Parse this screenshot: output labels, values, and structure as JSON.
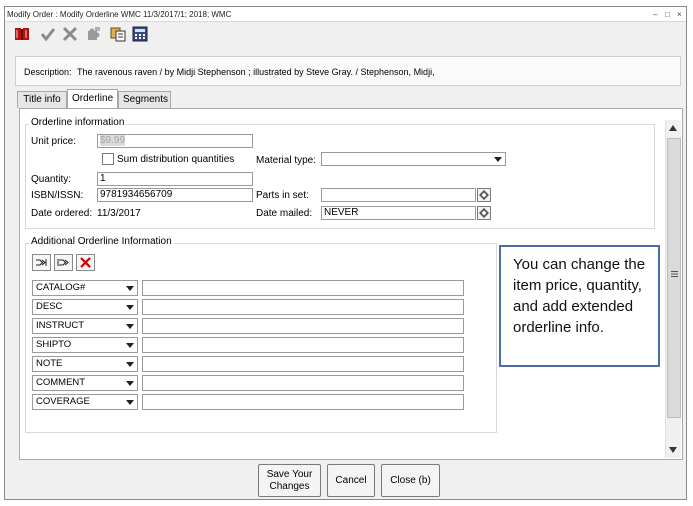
{
  "window": {
    "title": "Modify Order : Modify Orderline  WMC 11/3/2017/1; 2018; WMC",
    "controls": [
      "‒",
      "□",
      "×"
    ]
  },
  "toolbar": {
    "icons": [
      "book-icon",
      "checkmark-icon",
      "tools-icon",
      "puzzle-icon",
      "copy-icon",
      "calculator-icon"
    ]
  },
  "description": {
    "label": "Description:",
    "value": "The ravenous raven / by Midji Stephenson ; illustrated by Steve Gray. / Stephenson, Midji,"
  },
  "tabs": [
    {
      "label": "Title info",
      "active": false
    },
    {
      "label": "Orderline",
      "active": true
    },
    {
      "label": "Segments",
      "active": false
    }
  ],
  "orderline_info": {
    "title": "Orderline information",
    "unit_price_label": "Unit price:",
    "unit_price_value": "$9.99",
    "sum_distribution_label": "Sum distribution quantities",
    "sum_distribution_checked": false,
    "material_type_label": "Material type:",
    "material_type_value": "",
    "quantity_label": "Quantity:",
    "quantity_value": "1",
    "isbn_label": "ISBN/ISSN:",
    "isbn_value": "9781934656709",
    "parts_label": "Parts in set:",
    "parts_value": "",
    "date_ordered_label": "Date ordered:",
    "date_ordered_value": "11/3/2017",
    "date_mailed_label": "Date mailed:",
    "date_mailed_value": "NEVER"
  },
  "additional": {
    "title": "Additional Orderline Information",
    "rows": [
      {
        "type": "CATALOG#",
        "value": ""
      },
      {
        "type": "DESC",
        "value": ""
      },
      {
        "type": "INSTRUCT",
        "value": ""
      },
      {
        "type": "SHIPTO",
        "value": ""
      },
      {
        "type": "NOTE",
        "value": ""
      },
      {
        "type": "COMMENT",
        "value": ""
      },
      {
        "type": "COVERAGE",
        "value": ""
      }
    ]
  },
  "callout": {
    "text": "You can change the item price, quantity, and add extended orderline info."
  },
  "buttons": {
    "save_line1": "Save Your",
    "save_line2": "Changes",
    "cancel": "Cancel",
    "close": "Close (b)"
  },
  "colors": {
    "callout_border": "#4a6fa5",
    "delete_red": "#cc0000"
  }
}
